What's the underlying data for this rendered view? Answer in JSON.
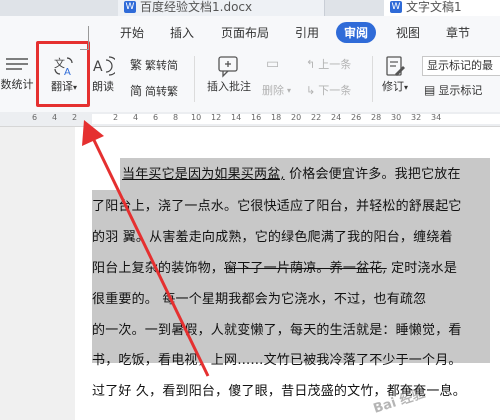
{
  "title_tabs": [
    {
      "label": "百度经验文档1.docx"
    },
    {
      "label": "文字文稿1"
    }
  ],
  "menu": {
    "items": [
      "开始",
      "插入",
      "页面布局",
      "引用",
      "审阅",
      "视图",
      "章节"
    ],
    "active": "审阅"
  },
  "ribbon": {
    "word_count": "数统计",
    "translate": "翻译",
    "read_aloud": "朗读",
    "trad_to_simp": "繁转简",
    "simp_to_trad": "简转繁",
    "insert_comment": "插入批注",
    "delete": "删除",
    "prev_comment": "上一条",
    "next_comment": "下一条",
    "track_changes": "修订",
    "show_markup_final": "显示标记的最",
    "show_markup": "显示标记"
  },
  "ruler": {
    "numbers": [
      "6",
      "4",
      "2",
      "2",
      "4",
      "6",
      "8",
      "10",
      "12",
      "14",
      "16",
      "18",
      "20",
      "22",
      "24",
      "26",
      "28",
      "30",
      "32",
      "34"
    ]
  },
  "document": {
    "l1_a": "当年买它是因为如果买两盆,",
    "l1_b": " 价格会便宜许多。我把它放在",
    "l2": "了阳台上，浇了一点水。它很快适应了阳台，并轻松的舒展起它",
    "l3": "的羽  翼。从害羞走向成熟，它的绿色爬满了我的阳台，缠绕着",
    "l4_a": "阳台上复杂的装饰物，",
    "l4_b": "窗下了一片荫凉。养一盆花,",
    "l4_c": " 定时浇水是",
    "l5": "很重要的。  每一个星期我都会为它浇水，不过，也有疏忽",
    "l6": "的一次。一到暑假，人就变懒了，每天的生活就是：睡懒觉，看",
    "l7": "书，吃饭，看电视，上网……文竹已被我冷落了不少于一个月。",
    "l8": "过了好  久，看到阳台，傻了眼，昔日茂盛的文竹，都奄奄一息。"
  },
  "watermark": "Bai 经验"
}
